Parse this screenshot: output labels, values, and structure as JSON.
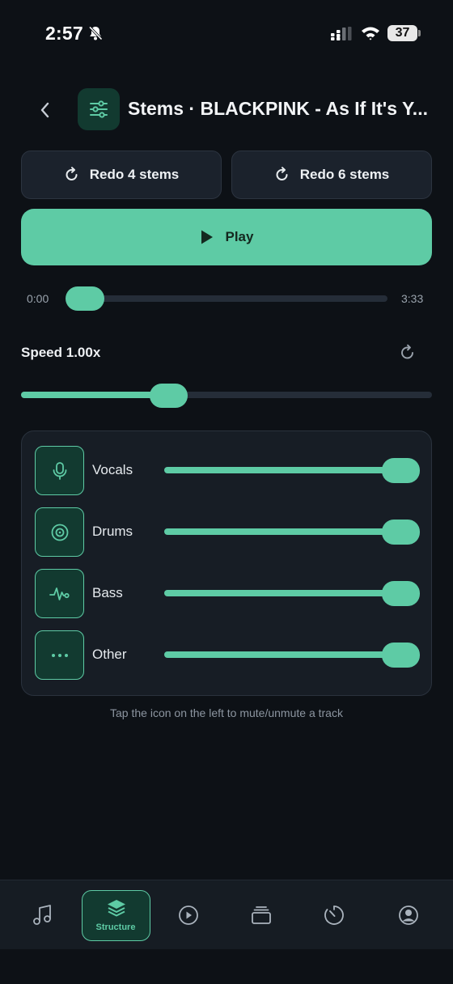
{
  "status_bar": {
    "time": "2:57",
    "battery": "37"
  },
  "header": {
    "title": "Stems · BLACKPINK - As If It's Y..."
  },
  "actions": {
    "redo4_label": "Redo 4 stems",
    "redo6_label": "Redo 6 stems",
    "play_label": "Play"
  },
  "playback": {
    "current": "0:00",
    "total": "3:33",
    "progress": 0
  },
  "speed": {
    "label": "Speed 1.00x",
    "value": 1.0,
    "level": 0.36
  },
  "stems": [
    {
      "label": "Vocals",
      "icon": "mic-icon",
      "level": 1.0
    },
    {
      "label": "Drums",
      "icon": "drum-icon",
      "level": 1.0
    },
    {
      "label": "Bass",
      "icon": "waveform-icon",
      "level": 1.0
    },
    {
      "label": "Other",
      "icon": "more-dots-icon",
      "level": 1.0
    }
  ],
  "hint": "Tap the icon on the left to mute/unmute a track",
  "nav": {
    "active_label": "Structure"
  },
  "colors": {
    "accent": "#5ecba5",
    "background": "#0d1116",
    "card": "#171d25"
  }
}
